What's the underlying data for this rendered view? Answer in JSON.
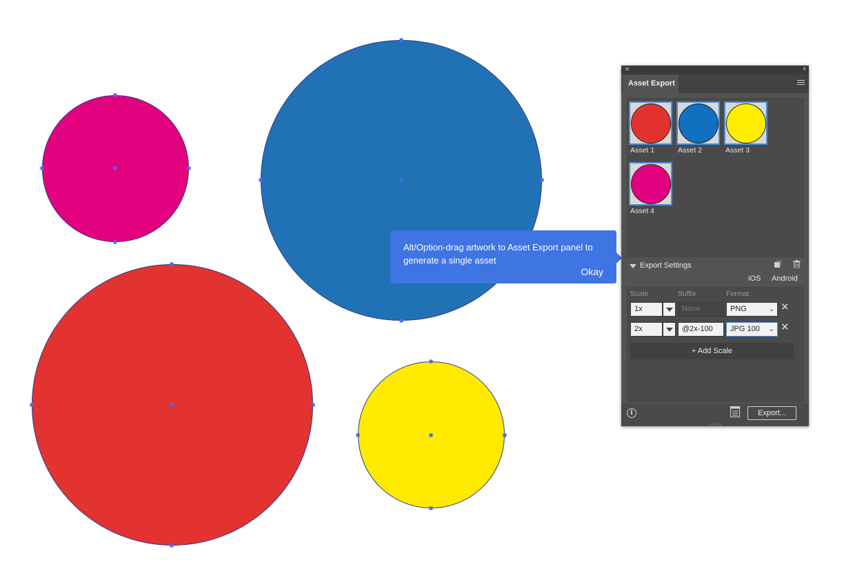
{
  "artboard": {
    "circles": [
      {
        "name": "magenta",
        "color": "#e2027f"
      },
      {
        "name": "blue",
        "color": "#2171b5"
      },
      {
        "name": "red",
        "color": "#e23330"
      },
      {
        "name": "yellow",
        "color": "#ffea00"
      }
    ]
  },
  "tooltip": {
    "message": "Alt/Option-drag artwork to Asset Export panel to generate a single asset",
    "okay_label": "Okay"
  },
  "panel": {
    "title": "Asset Export",
    "assets": [
      {
        "label": "Asset 1",
        "color": "#e23330"
      },
      {
        "label": "Asset 2",
        "color": "#1170c0"
      },
      {
        "label": "Asset 3",
        "color": "#ffee00"
      },
      {
        "label": "Asset 4",
        "color": "#e2027f"
      }
    ],
    "export_settings": {
      "title": "Export Settings",
      "ios_label": "iOS",
      "android_label": "Android",
      "columns": {
        "scale": "Scale",
        "suffix": "Suffix",
        "format": "Format"
      },
      "rows": [
        {
          "scale": "1x",
          "suffix": "",
          "suffix_placeholder": "None",
          "format": "PNG"
        },
        {
          "scale": "2x",
          "suffix": "@2x-100",
          "suffix_placeholder": "",
          "format": "JPG 100"
        }
      ],
      "add_scale_label": "+ Add Scale"
    },
    "export_button_label": "Export..."
  }
}
